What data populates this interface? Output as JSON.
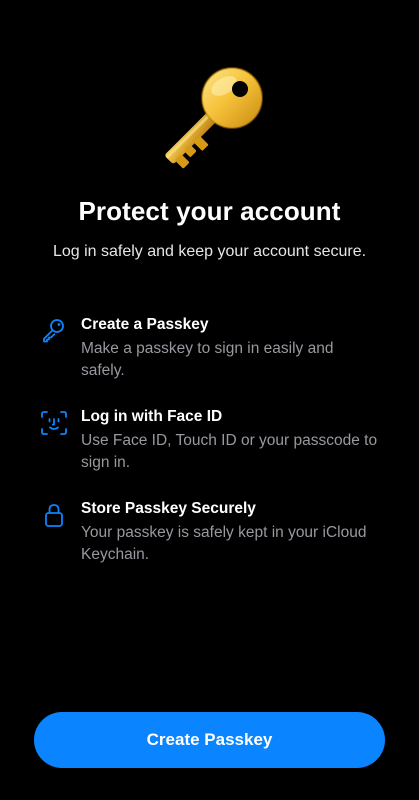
{
  "header": {
    "title": "Protect your account",
    "subtitle": "Log in safely and keep your account secure."
  },
  "illustration": {
    "icon": "golden-key"
  },
  "features": [
    {
      "icon": "key-icon",
      "title": "Create a Passkey",
      "description": "Make a passkey to sign in easily and safely."
    },
    {
      "icon": "face-id-icon",
      "title": "Log in with Face ID",
      "description": "Use Face ID, Touch ID or your passcode to sign in."
    },
    {
      "icon": "lock-icon",
      "title": "Store Passkey Securely",
      "description": "Your passkey is safely kept in your iCloud Keychain."
    }
  ],
  "actions": {
    "primary_label": "Create Passkey"
  },
  "colors": {
    "background": "#000000",
    "accent": "#0a84ff",
    "icon_blue": "#0a84ff",
    "secondary_text": "#98989f",
    "key_gold": "#f5c542"
  }
}
